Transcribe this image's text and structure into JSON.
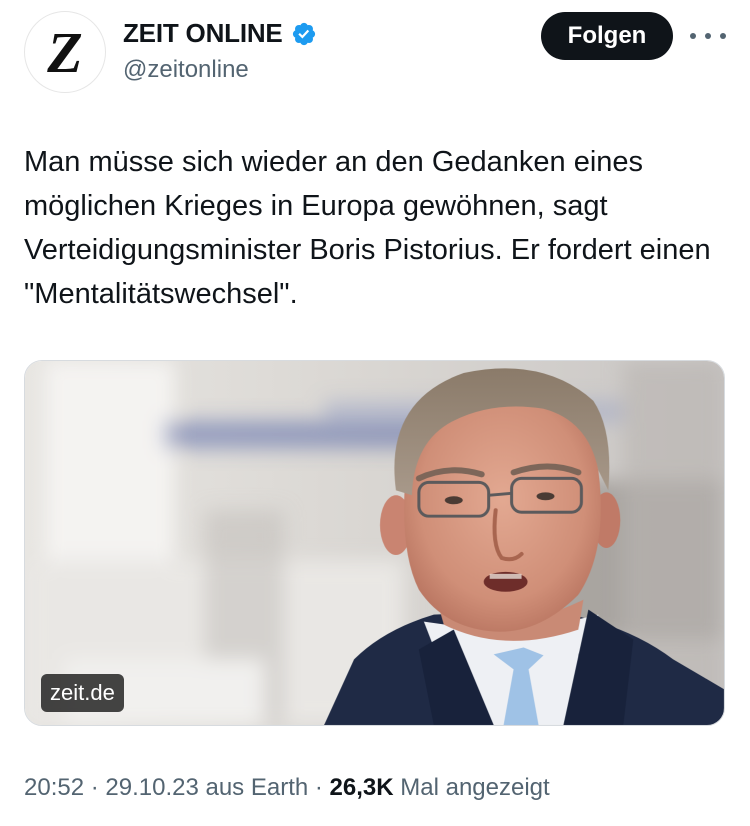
{
  "author": {
    "avatar_letter": "Z",
    "name": "ZEIT ONLINE",
    "handle": "@zeitonline",
    "verified_icon": "verified-badge-icon",
    "verified_color": "#1d9bf0"
  },
  "actions": {
    "follow_label": "Folgen",
    "more_icon": "more-horizontal-icon"
  },
  "tweet": {
    "text": "Man müsse sich wieder an den Gedanken eines möglichen Krieges in Europa gewöhnen, sagt Verteidigungsminister Boris Pistorius. Er fordert einen \"Mentalitätswechsel\"."
  },
  "media": {
    "domain": "zeit.de"
  },
  "meta": {
    "time": "20:52",
    "sep1": " · ",
    "date": "29.10.23",
    "source": " aus Earth",
    "sep2": " · ",
    "views": "26,3K",
    "views_label": " Mal angezeigt"
  },
  "colors": {
    "follow_bg": "#0f1419",
    "text_secondary": "#536471"
  }
}
